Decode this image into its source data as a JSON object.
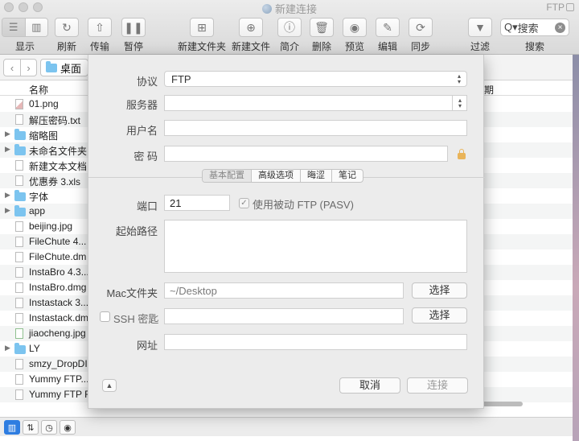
{
  "window": {
    "title": "新建连接",
    "badge": "FTP"
  },
  "toolbar": {
    "view_label": "显示",
    "refresh_label": "刷新",
    "transfer_label": "传输",
    "pause_label": "暂停",
    "new_folder_label": "新建文件夹",
    "new_file_label": "新建文件",
    "info_label": "简介",
    "delete_label": "删除",
    "preview_label": "预览",
    "edit_label": "编辑",
    "sync_label": "同步",
    "filter_label": "过滤",
    "search_label": "搜索",
    "search_value": "搜索"
  },
  "pathbar": {
    "current_folder": "桌面"
  },
  "filelist": {
    "header_name": "名称",
    "header_date": "期",
    "rows": [
      {
        "name": "01.png",
        "type": "image",
        "expandable": false
      },
      {
        "name": "解压密码.txt",
        "type": "doc",
        "expandable": false
      },
      {
        "name": "缩略图",
        "type": "folder",
        "expandable": true
      },
      {
        "name": "未命名文件夹",
        "type": "folder",
        "expandable": true
      },
      {
        "name": "新建文本文档",
        "type": "doc",
        "expandable": false
      },
      {
        "name": "优惠券 3.xls",
        "type": "doc",
        "expandable": false
      },
      {
        "name": "字体",
        "type": "folder",
        "expandable": true
      },
      {
        "name": "app",
        "type": "folder",
        "expandable": true
      },
      {
        "name": "beijing.jpg",
        "type": "doc",
        "expandable": false
      },
      {
        "name": "FileChute 4...",
        "type": "doc",
        "expandable": false
      },
      {
        "name": "FileChute.dm",
        "type": "doc",
        "expandable": false
      },
      {
        "name": "InstaBro 4.3...",
        "type": "doc",
        "expandable": false
      },
      {
        "name": "InstaBro.dmg",
        "type": "doc",
        "expandable": false
      },
      {
        "name": "Instastack 3...",
        "type": "doc",
        "expandable": false
      },
      {
        "name": "Instastack.dm",
        "type": "doc",
        "expandable": false
      },
      {
        "name": "jiaocheng.jpg",
        "type": "green",
        "expandable": false
      },
      {
        "name": "LY",
        "type": "folder",
        "expandable": true
      },
      {
        "name": "smzy_DropDI",
        "type": "doc",
        "expandable": false
      },
      {
        "name": "Yummy FTP...",
        "type": "doc",
        "expandable": false
      },
      {
        "name": "Yummy FTP F",
        "type": "doc",
        "expandable": false
      }
    ]
  },
  "dialog": {
    "protocol_label": "协议",
    "protocol_value": "FTP",
    "server_label": "服务器",
    "server_value": "",
    "username_label": "用户名",
    "username_value": "",
    "password_label": "密 码",
    "password_value": "",
    "tabs": [
      "基本配置",
      "高级选项",
      "晦涩",
      "笔记"
    ],
    "port_label": "端口",
    "port_value": "21",
    "pasv_label": "使用被动 FTP (PASV)",
    "pasv_checked": true,
    "start_path_label": "起始路径",
    "mac_folder_label": "Mac文件夹",
    "mac_folder_value": "~/Desktop",
    "choose_label": "选择",
    "ssh_key_label": "SSH 密匙",
    "ssh_choose_label": "选择",
    "url_label": "网址",
    "cancel_label": "取消",
    "connect_label": "连接"
  }
}
